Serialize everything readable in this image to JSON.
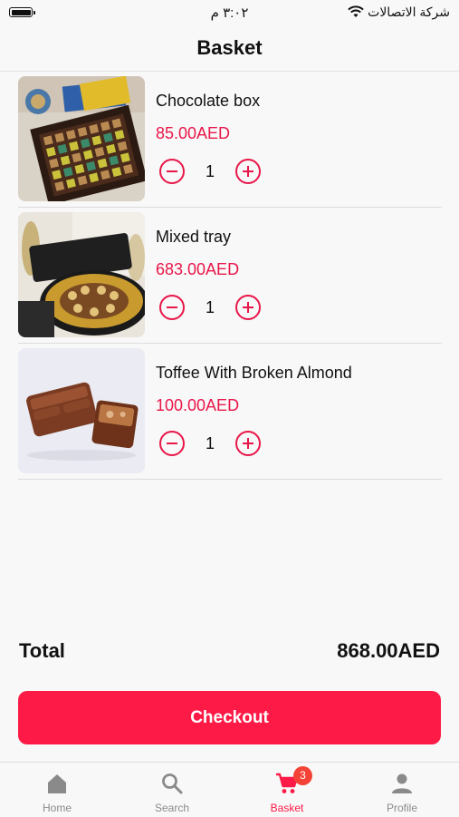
{
  "status_bar": {
    "time": "٣:٠٢ م",
    "carrier": "شركة الاتصالات"
  },
  "header": {
    "title": "Basket"
  },
  "items": [
    {
      "name": "Chocolate box",
      "price": "85.00AED",
      "quantity": "1"
    },
    {
      "name": "Mixed tray",
      "price": "683.00AED",
      "quantity": "1"
    },
    {
      "name": "Toffee With Broken Almond",
      "price": "100.00AED",
      "quantity": "1"
    }
  ],
  "total": {
    "label": "Total",
    "value": "868.00AED"
  },
  "checkout": {
    "label": "Checkout"
  },
  "tabs": [
    {
      "label": "Home",
      "icon": "home-icon"
    },
    {
      "label": "Search",
      "icon": "search-icon"
    },
    {
      "label": "Basket",
      "icon": "cart-icon",
      "badge": "3",
      "active": true
    },
    {
      "label": "Profile",
      "icon": "person-icon"
    }
  ],
  "colors": {
    "accent": "#fe1a47",
    "price": "#e8174a",
    "badge": "#f44336"
  }
}
